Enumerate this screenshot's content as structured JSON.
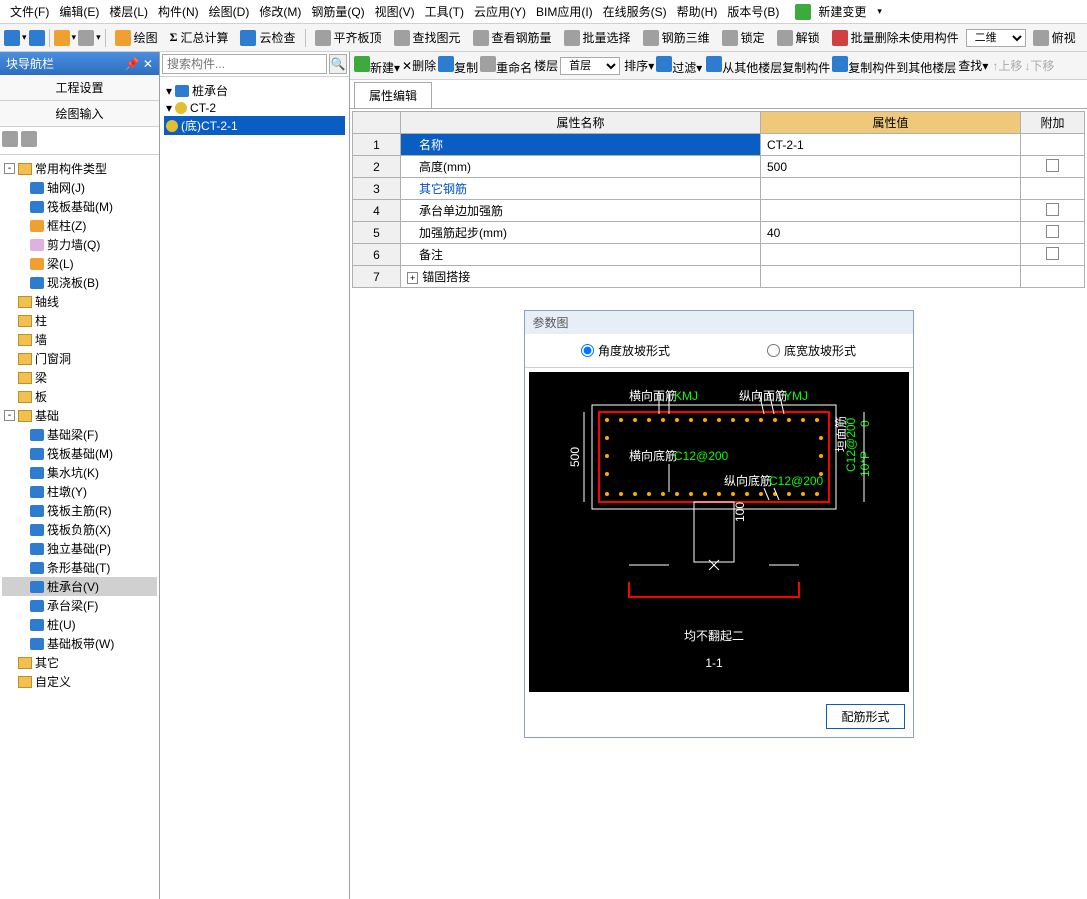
{
  "menus": [
    "文件(F)",
    "编辑(E)",
    "楼层(L)",
    "构件(N)",
    "绘图(D)",
    "修改(M)",
    "钢筋量(Q)",
    "视图(V)",
    "工具(T)",
    "云应用(Y)",
    "BIM应用(I)",
    "在线服务(S)",
    "帮助(H)",
    "版本号(B)"
  ],
  "newChange": "新建变更",
  "toolbar1": [
    "绘图",
    "汇总计算",
    "云检查",
    "平齐板顶",
    "查找图元",
    "查看钢筋量",
    "批量选择",
    "钢筋三维",
    "锁定",
    "解锁",
    "批量删除未使用构件"
  ],
  "viewMode": "二维",
  "overlook": "俯视",
  "navTitle": "块导航栏",
  "navTabs": [
    "工程设置",
    "绘图输入"
  ],
  "tree": {
    "root": "常用构件类型",
    "items": [
      "轴网(J)",
      "筏板基础(M)",
      "框柱(Z)",
      "剪力墙(Q)",
      "梁(L)",
      "现浇板(B)"
    ],
    "folders": [
      "轴线",
      "柱",
      "墙",
      "门窗洞",
      "梁",
      "板"
    ],
    "base": "基础",
    "baseItems": [
      "基础梁(F)",
      "筏板基础(M)",
      "集水坑(K)",
      "柱墩(Y)",
      "筏板主筋(R)",
      "筏板负筋(X)",
      "独立基础(P)",
      "条形基础(T)",
      "桩承台(V)",
      "承台梁(F)",
      "桩(U)",
      "基础板带(W)"
    ],
    "other": "其它",
    "custom": "自定义"
  },
  "ctoolbar": [
    "新建",
    "删除",
    "复制",
    "重命名",
    "楼层",
    "首层"
  ],
  "searchPlaceholder": "搜索构件...",
  "ctree": {
    "root": "桩承台",
    "l1": "CT-2",
    "l2": "(底)CT-2-1"
  },
  "rtoolbar": [
    "排序",
    "过滤",
    "从其他楼层复制构件",
    "复制构件到其他楼层",
    "查找",
    "上移",
    "下移"
  ],
  "propTab": "属性编辑",
  "propHeaders": [
    "属性名称",
    "属性值",
    "附加"
  ],
  "propRows": [
    {
      "n": "1",
      "name": "名称",
      "val": "CT-2-1",
      "chk": ""
    },
    {
      "n": "2",
      "name": "高度(mm)",
      "val": "500",
      "chk": "y"
    },
    {
      "n": "3",
      "name": "其它钢筋",
      "val": "",
      "chk": "",
      "blue": true
    },
    {
      "n": "4",
      "name": "承台单边加强筋",
      "val": "",
      "chk": "y"
    },
    {
      "n": "5",
      "name": "加强筋起步(mm)",
      "val": "40",
      "chk": "y"
    },
    {
      "n": "6",
      "name": "备注",
      "val": "",
      "chk": "y"
    },
    {
      "n": "7",
      "name": "锚固搭接",
      "val": "",
      "chk": "",
      "exp": true
    }
  ],
  "param": {
    "title": "参数图",
    "r1": "角度放坡形式",
    "r2": "底宽放坡形式",
    "labels": {
      "h1": "横向面筋",
      "h1c": "KMJ",
      "v1": "纵向面筋",
      "v1c": "YMJ",
      "h2": "横向底筋",
      "h2c": "C12@200",
      "v2": "纵向底筋",
      "v2c": "C12@200",
      "side": "垣面筋",
      "sidec": "C12@200",
      "d500": "500",
      "d100": "100",
      "d10p": "10*P",
      "d0": "0"
    },
    "caption1": "均不翻起二",
    "caption2": "1-1",
    "btn": "配筋形式"
  }
}
